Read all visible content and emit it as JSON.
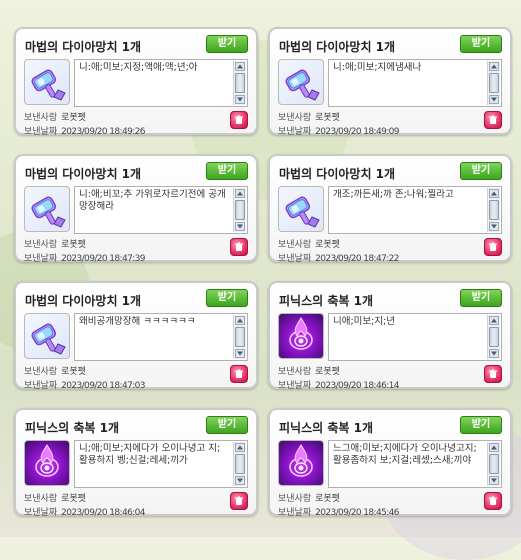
{
  "common": {
    "claim_label": "받기",
    "sender_label": "보낸사람",
    "date_label": "보낸날짜"
  },
  "colors": {
    "claim_button": "#3ea51e",
    "delete_button": "#e8336a",
    "hammer_icon_bg": "#dfe7f6",
    "phoenix_icon_bg": "#8a14c8"
  },
  "gifts": [
    {
      "title": "마법의 다이아망치 1개",
      "icon": "diamond-hammer-icon",
      "message": "니:애;미보;지정;액애;액;년;아",
      "sender": "로봇펫",
      "date": "2023/09/20 18:49:26"
    },
    {
      "title": "마법의 다이아망치 1개",
      "icon": "diamond-hammer-icon",
      "message": "니:애;미보;지에냄새나",
      "sender": "로봇펫",
      "date": "2023/09/20 18:49:09"
    },
    {
      "title": "마법의 다이아망치 1개",
      "icon": "diamond-hammer-icon",
      "message": "니:애;비꼬;추 가위로자르기전에 공개망장해라",
      "sender": "로봇펫",
      "date": "2023/09/20 18:47:39"
    },
    {
      "title": "마법의 다이아망치 1개",
      "icon": "diamond-hammer-icon",
      "message": "개조;까든새;까 존;나워;찔라고",
      "sender": "로봇펫",
      "date": "2023/09/20 18:47:22"
    },
    {
      "title": "마법의 다이아망치 1개",
      "icon": "diamond-hammer-icon",
      "message": "왜비공개망장해 ㅋㅋㅋㅋㅋㅋ",
      "sender": "로봇펫",
      "date": "2023/09/20 18:47:03"
    },
    {
      "title": "피닉스의 축복 1개",
      "icon": "phoenix-blessing-icon",
      "message": "니애;미보;지;년",
      "sender": "로봇펫",
      "date": "2023/09/20 18:46:14"
    },
    {
      "title": "피닉스의 축복 1개",
      "icon": "phoenix-blessing-icon",
      "message": "니;애;미보;지에다가 오이나녕고 지;활용하지 벵;신걸;레세;끼가",
      "sender": "로봇펫",
      "date": "2023/09/20 18:46:04"
    },
    {
      "title": "피닉스의 축복 1개",
      "icon": "phoenix-blessing-icon",
      "message": "느그애;미보;지에다가 오이나녕고지;활용좀하지 보;지걸;레셌;스새;끼야",
      "sender": "로봇펫",
      "date": "2023/09/20 18:45:46"
    }
  ]
}
